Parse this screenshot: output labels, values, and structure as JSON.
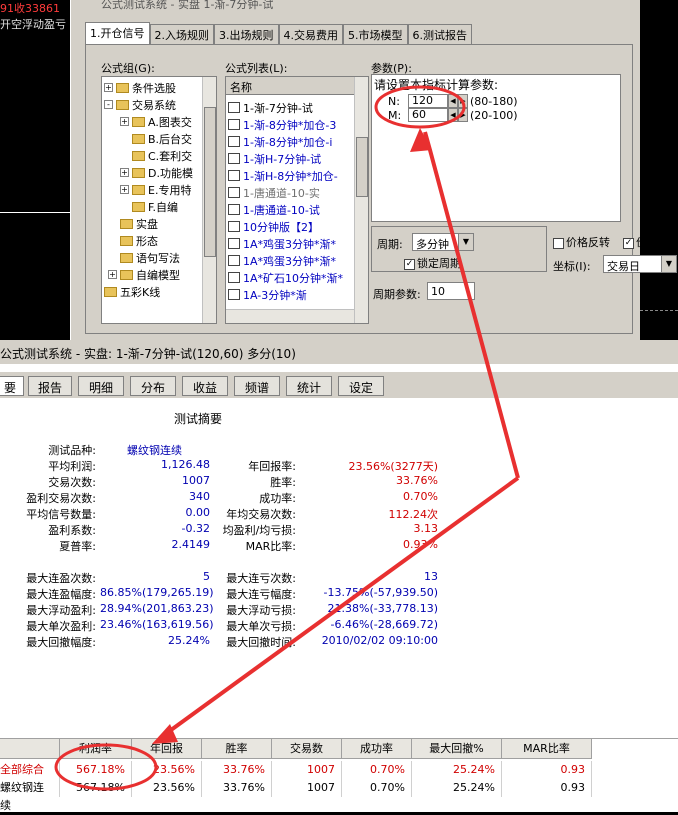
{
  "bg": {
    "left_line1": "91收33861",
    "left_line2": "开空浮动盈亏"
  },
  "dialog": {
    "title_fragment": "公式测试系统 - 实盘 1-渐-7分钟-试",
    "tabs": [
      "1.开仓信号",
      "2.入场规则",
      "3.出场规则",
      "4.交易费用",
      "5.市场模型",
      "6.测试报告"
    ],
    "group_label": "公式组(G):",
    "tree": [
      {
        "label": "条件选股",
        "expander": "+"
      },
      {
        "label": "交易系统",
        "expander": "-"
      },
      {
        "label": "A.图表交",
        "expander": "+"
      },
      {
        "label": "B.后台交",
        "expander": ""
      },
      {
        "label": "C.套利交",
        "expander": ""
      },
      {
        "label": "D.功能模",
        "expander": "+"
      },
      {
        "label": "E.专用特",
        "expander": "+"
      },
      {
        "label": "F.自编",
        "expander": ""
      },
      {
        "label": "实盘",
        "expander": ""
      },
      {
        "label": "形态",
        "expander": ""
      },
      {
        "label": "语句写法",
        "expander": ""
      },
      {
        "label": "自编模型",
        "expander": "+"
      },
      {
        "label": "五彩K线",
        "expander": ""
      }
    ],
    "list_label": "公式列表(L):",
    "list_header": "名称",
    "list": [
      "1-渐-7分钟-试",
      "1-渐-8分钟*加仓-3",
      "1-渐-8分钟*加仓-i",
      "1-渐H-7分钟-试",
      "1-渐H-8分钟*加仓-",
      "1-唐通道-10-实",
      "1-唐通道-10-试",
      "10分钟版【2】",
      "1A*鸡蛋3分钟*渐*",
      "1A*鸡蛋3分钟*渐*",
      "1A*矿石10分钟*渐*",
      "1A-3分钟*渐"
    ],
    "param_label": "参数(P):",
    "param_hint": "请设置本指标计算参数:",
    "params": [
      {
        "name": "N:",
        "value": "120",
        "range": "(80-180)"
      },
      {
        "name": "M:",
        "value": "60",
        "range": "(20-100)"
      }
    ],
    "period_label": "周期:",
    "period_value": "多分钟",
    "lock_period": "锁定周期",
    "price_reverse": "价格反转",
    "price_restore": "价格复权",
    "coord_label": "坐标(I):",
    "coord_value": "交易日",
    "period_param_label": "周期参数:",
    "period_param_value": "10"
  },
  "lower": {
    "title": "公式测试系统 - 实盘: 1-渐-7分钟-试(120,60) 多分(10)",
    "tabs": [
      "要",
      "报告",
      "明细",
      "分布",
      "收益",
      "频谱",
      "统计",
      "设定"
    ],
    "summary_title": "测试摘要",
    "left_rows": [
      {
        "label": "测试品种:",
        "value": "螺纹钢连续"
      },
      {
        "label": "平均利润:",
        "value": "1,126.48"
      },
      {
        "label": "交易次数:",
        "value": "1007"
      },
      {
        "label": "盈利交易次数:",
        "value": "340"
      },
      {
        "label": "平均信号数量:",
        "value": "0.00"
      },
      {
        "label": "盈利系数:",
        "value": "-0.32"
      },
      {
        "label": "夏普率:",
        "value": "2.4149"
      }
    ],
    "right_rows": [
      {
        "label": "年回报率:",
        "value": "23.56%(3277天)"
      },
      {
        "label": "胜率:",
        "value": "33.76%"
      },
      {
        "label": "成功率:",
        "value": "0.70%"
      },
      {
        "label": "年均交易次数:",
        "value": "112.24次"
      },
      {
        "label": "均盈利/均亏损:",
        "value": "3.13"
      },
      {
        "label": "MAR比率:",
        "value": "0.93%"
      }
    ],
    "left_rows2": [
      {
        "label": "最大连盈次数:",
        "value": "5"
      },
      {
        "label": "最大连盈幅度:",
        "value": "86.85%(179,265.19)"
      },
      {
        "label": "最大浮动盈利:",
        "value": "28.94%(201,863.23)"
      },
      {
        "label": "最大单次盈利:",
        "value": "23.46%(163,619.56)"
      },
      {
        "label": "最大回撤幅度:",
        "value": "25.24%"
      }
    ],
    "right_rows2": [
      {
        "label": "最大连亏次数:",
        "value": "13"
      },
      {
        "label": "最大连亏幅度:",
        "value": "-13.75%(-57,939.50)"
      },
      {
        "label": "最大浮动亏损:",
        "value": "21.38%(-33,778.13)"
      },
      {
        "label": "最大单次亏损:",
        "value": "-6.46%(-28,669.72)"
      },
      {
        "label": "最大回撤时间:",
        "value": "2010/02/02 09:10:00"
      }
    ],
    "grid_headers": [
      "",
      "利润率",
      "年回报",
      "胜率",
      "交易数",
      "成功率",
      "最大回撤%",
      "MAR比率"
    ],
    "grid_rows": [
      [
        "全部综合",
        "567.18%",
        "23.56%",
        "33.76%",
        "1007",
        "0.70%",
        "25.24%",
        "0.93"
      ],
      [
        "螺纹钢连续",
        "567.18%",
        "23.56%",
        "33.76%",
        "1007",
        "0.70%",
        "25.24%",
        "0.93"
      ]
    ]
  },
  "annotation_color": "#e83030"
}
